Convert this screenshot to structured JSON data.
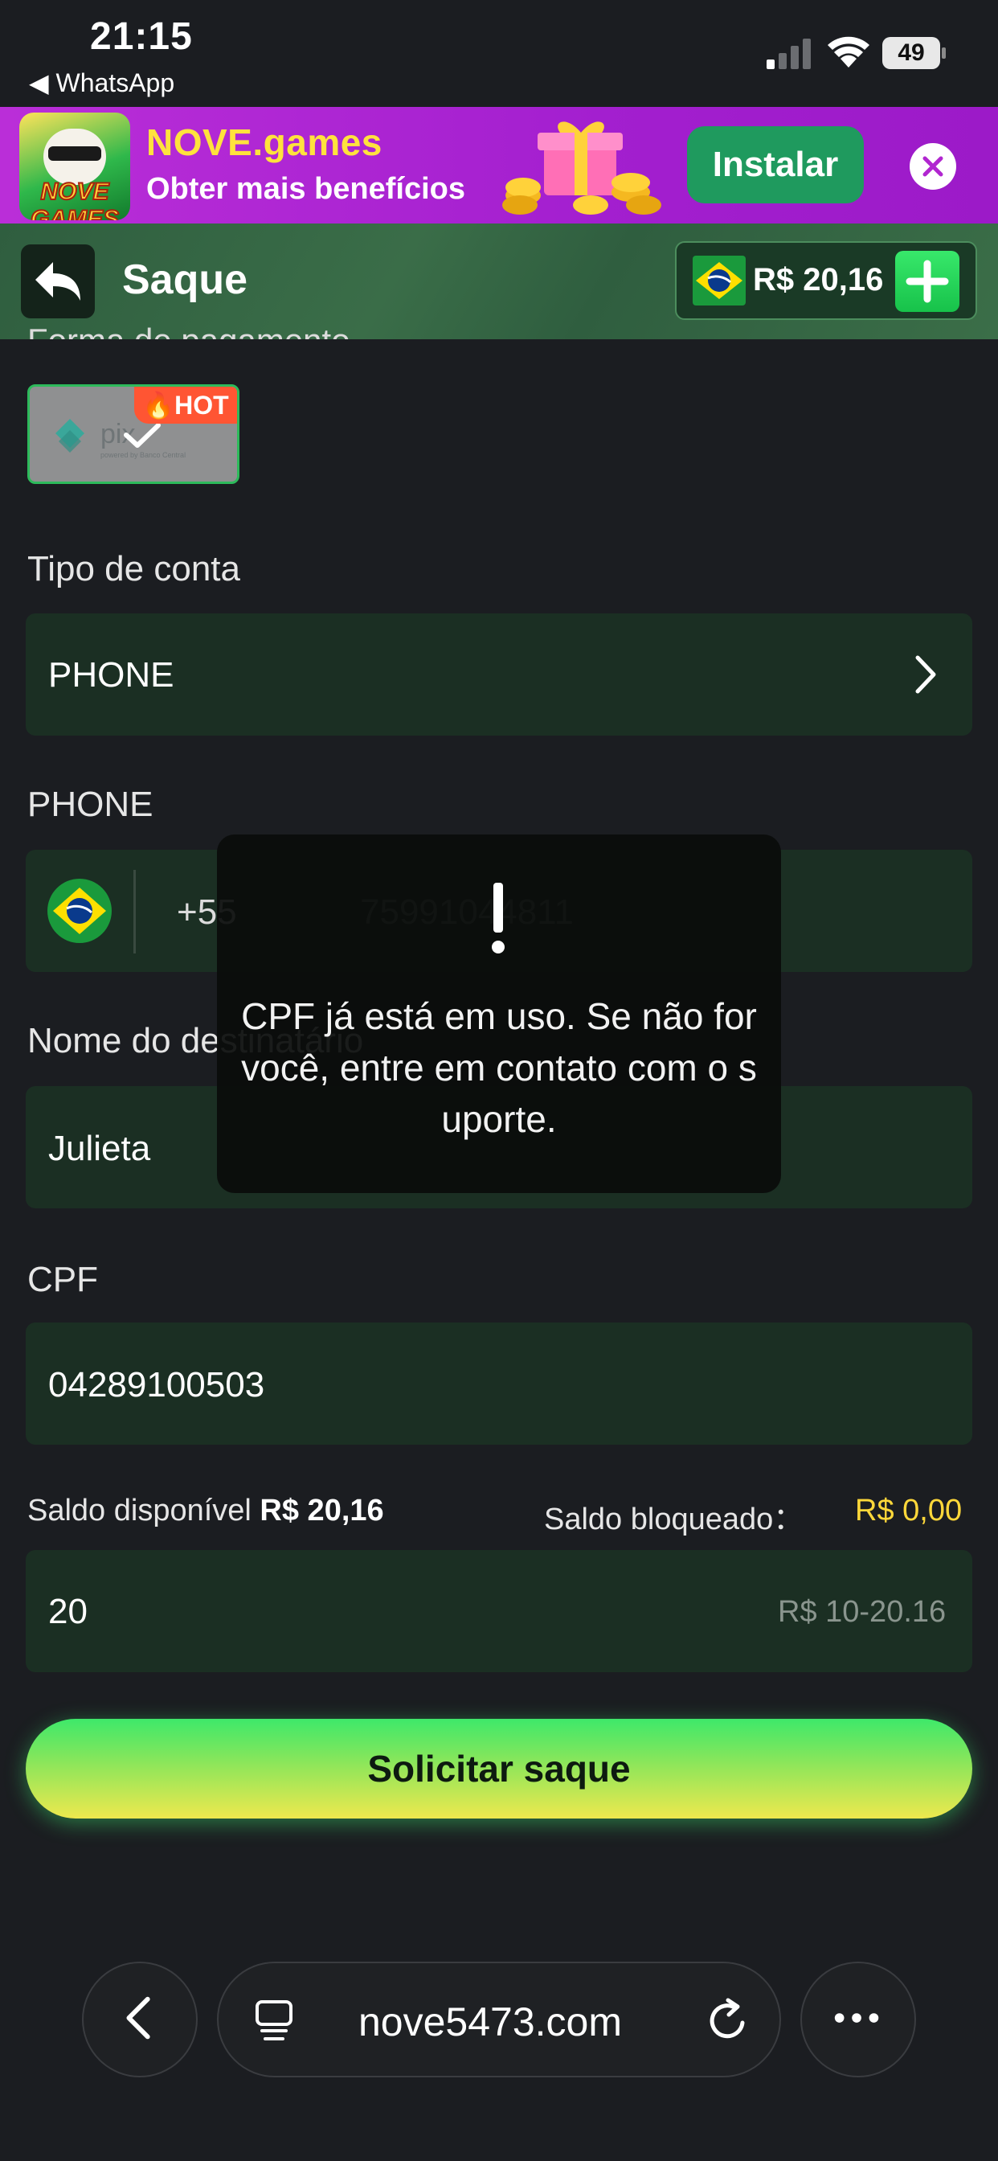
{
  "status_bar": {
    "time": "21:15",
    "back_to_app": "◀ WhatsApp",
    "battery": "49"
  },
  "promo": {
    "logo_text": "NOVE GAMES",
    "title": "NOVE.games",
    "subtitle": "Obter mais benefícios",
    "install_label": "Instalar"
  },
  "header": {
    "title": "Saque",
    "balance": "R$ 20,16"
  },
  "form": {
    "payment_label": "Forma de pagamento",
    "pix_badge": "HOT",
    "account_type_label": "Tipo de conta",
    "account_type_value": "PHONE",
    "phone_label": "PHONE",
    "phone_code": "+55",
    "phone_number": "75991044811",
    "recipient_label": "Nome do destinatário",
    "recipient_value": "Julieta",
    "cpf_label": "CPF",
    "cpf_value": "04289100503",
    "available_label": "Saldo disponível",
    "available_value": "R$ 20,16",
    "blocked_label": "Saldo bloqueado：",
    "blocked_value": "R$ 0,00",
    "amount_value": "20",
    "amount_range": "R$ 10-20.16",
    "submit_label": "Solicitar saque"
  },
  "toast": {
    "message": "CPF já está em uso. Se não for você, entre em contato com o suporte."
  },
  "browser": {
    "url": "nove5473.com"
  },
  "colors": {
    "accent_green": "#2dba5b",
    "field_bg": "#1b2f23",
    "warning_yellow": "#ffd83a",
    "promo_purple": "#ba2ed8"
  }
}
